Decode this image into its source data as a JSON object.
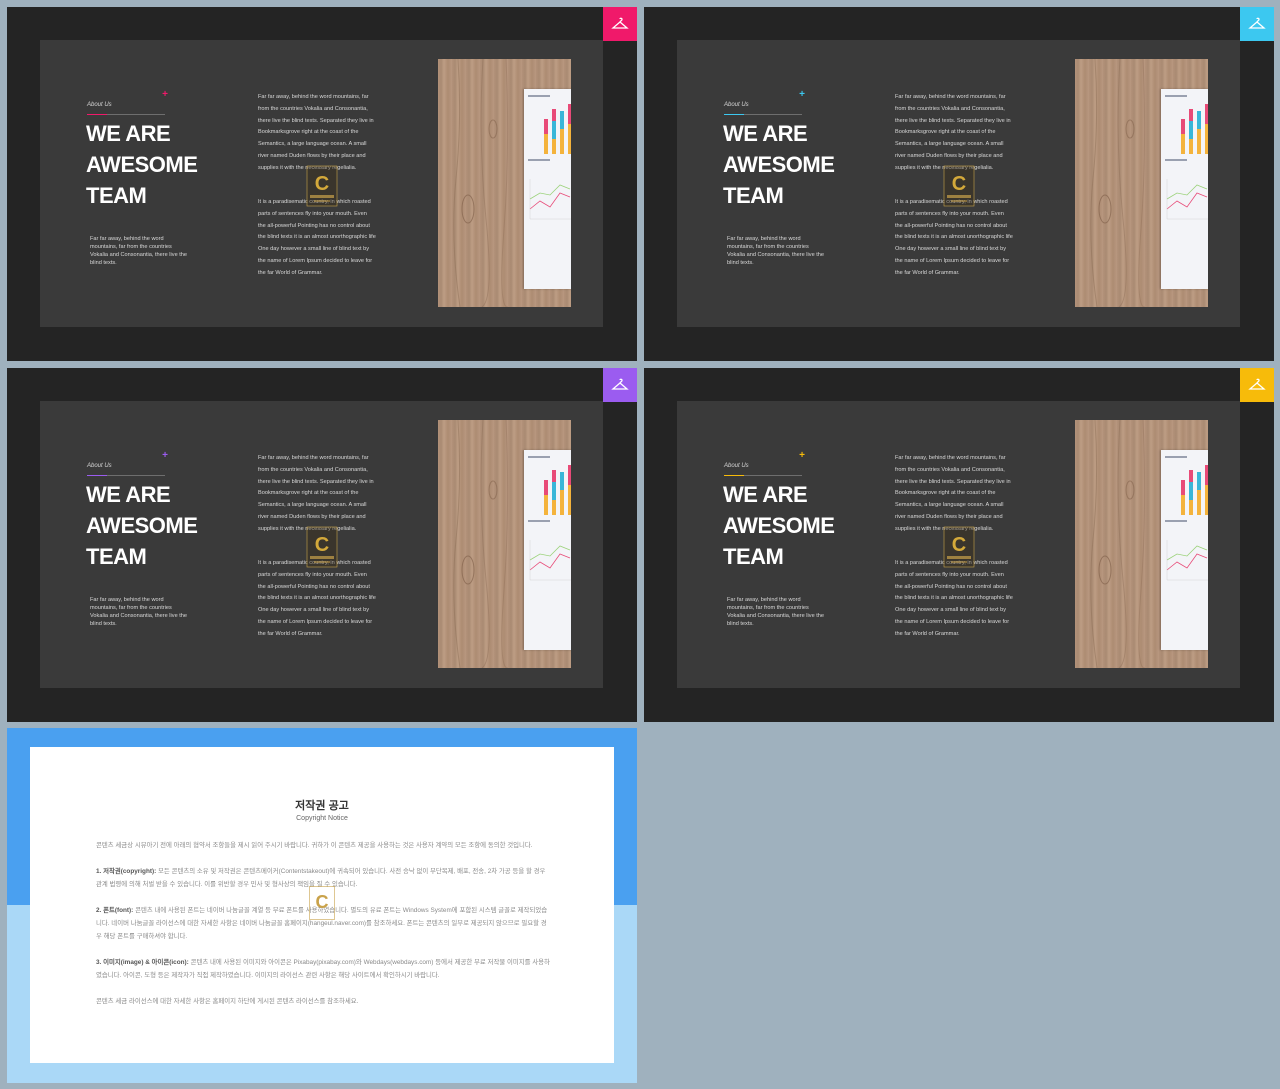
{
  "slides": [
    {
      "accent": "#f0196a",
      "corner_icon": "hanger-icon",
      "about_label": "About Us",
      "headline": [
        "WE ARE",
        "AWESOME",
        "TEAM"
      ],
      "small_text": "Far far away, behind the word mountains, far from the countries Vokalia and Consonantia, there live the blind texts.",
      "para1": "Far far away, behind the word mountains, far from the countries Vokalia and Consonantia, there live the blind texts. Separated they live in Bookmarksgrove right at the coast of the Semantics, a large language ocean. A small river named Duden flows by their place and supplies it with the necessary regelialia.",
      "para2": "It is a paradisematic country, in which roasted parts of sentences fly into your mouth. Even the all-powerful Pointing has no control about the blind texts it is an almost unorthographic life One day however a small line of blind text by the name of Lorem Ipsum decided to leave for the far World of Grammar."
    },
    {
      "accent": "#3cc8f0",
      "corner_icon": "hanger-icon",
      "about_label": "About Us",
      "headline": [
        "WE ARE",
        "AWESOME",
        "TEAM"
      ],
      "small_text": "Far far away, behind the word mountains, far from the countries Vokalia and Consonantia, there live the blind texts.",
      "para1": "Far far away, behind the word mountains, far from the countries Vokalia and Consonantia, there live the blind texts. Separated they live in Bookmarksgrove right at the coast of the Semantics, a large language ocean. A small river named Duden flows by their place and supplies it with the necessary regelialia.",
      "para2": "It is a paradisematic country, in which roasted parts of sentences fly into your mouth. Even the all-powerful Pointing has no control about the blind texts it is an almost unorthographic life One day however a small line of blind text by the name of Lorem Ipsum decided to leave for the far World of Grammar."
    },
    {
      "accent": "#9b5cf0",
      "corner_icon": "hanger-icon",
      "about_label": "About Us",
      "headline": [
        "WE ARE",
        "AWESOME",
        "TEAM"
      ],
      "small_text": "Far far away, behind the word mountains, far from the countries Vokalia and Consonantia, there live the blind texts.",
      "para1": "Far far away, behind the word mountains, far from the countries Vokalia and Consonantia, there live the blind texts. Separated they live in Bookmarksgrove right at the coast of the Semantics, a large language ocean. A small river named Duden flows by their place and supplies it with the necessary regelialia.",
      "para2": "It is a paradisematic country, in which roasted parts of sentences fly into your mouth. Even the all-powerful Pointing has no control about the blind texts it is an almost unorthographic life One day however a small line of blind text by the name of Lorem Ipsum decided to leave for the far World of Grammar."
    },
    {
      "accent": "#f7bb0a",
      "corner_icon": "hanger-icon",
      "about_label": "About Us",
      "headline": [
        "WE ARE",
        "AWESOME",
        "TEAM"
      ],
      "small_text": "Far far away, behind the word mountains, far from the countries Vokalia and Consonantia, there live the blind texts.",
      "para1": "Far far away, behind the word mountains, far from the countries Vokalia and Consonantia, there live the blind texts. Separated they live in Bookmarksgrove right at the coast of the Semantics, a large language ocean. A small river named Duden flows by their place and supplies it with the necessary regelialia.",
      "para2": "It is a paradisematic country, in which roasted parts of sentences fly into your mouth. Even the all-powerful Pointing has no control about the blind texts it is an almost unorthographic life One day however a small line of blind text by the name of Lorem Ipsum decided to leave for the far World of Grammar."
    }
  ],
  "copyright": {
    "title": "저작권 공고",
    "subtitle": "Copyright Notice",
    "intro": "콘텐츠 세금상 시뮤아기 전에 아래의 협약서 조항들을 제시 읽어 주시기 바랍니다. 귀하가 이 콘텐츠 제공을 사용하는 것은 사용자 계약의 모든 조항에 동의한 것입니다.",
    "s1_head": "1. 저작권(copyright):",
    "s1_body": "모든 콘텐츠의 소유 및 저작권은 콘텐츠메이커(Contentstakeout)에 귀속되어 있습니다. 사전 승낙 없이 무단복제, 배포, 전송, 2차 가공 등을 할 경우 관계 법령에 의해 처벌 받을 수 있습니다. 이를 위반할 경우 민사 및 형사상의 책임을 질 수 있습니다.",
    "s2_head": "2. 폰트(font):",
    "s2_body": "콘텐츠 내에 사용된 폰트는 네이버 나눔글꼴 계열 등 무료 폰트를 사용하였습니다. 별도의 유료 폰트는 Windows System에 포함된 시스템 글꼴로 제작되었습니다. 네이버 나눔글꼴 라이선스에 대한 자세한 사항은 네이버 나눔글꼴 홈페이지(hangeul.naver.com)를 참조하세요. 폰트는 콘텐츠의 일부로 제공되지 않으므로 필요할 경우 해당 폰트를 구매하셔야 합니다.",
    "s3_head": "3. 이미지(image) & 아이콘(icon):",
    "s3_body": "콘텐츠 내에 사용된 이미지와 아이콘은 Pixabay(pixabay.com)와 Webdays(webdays.com) 등에서 제공한 무료 저작물 이미지를 사용하였습니다. 아이콘, 도형 등은 제작자가 직접 제작하였습니다. 이미지의 라이선스 관련 사항은 해당 사이트에서 확인하시기 바랍니다.",
    "outro": "콘텐츠 세금 라이선스에 대한 자세한 사항은 홈페이지 하단에 게시된 콘텐츠 라이선스를 참조하세요."
  }
}
